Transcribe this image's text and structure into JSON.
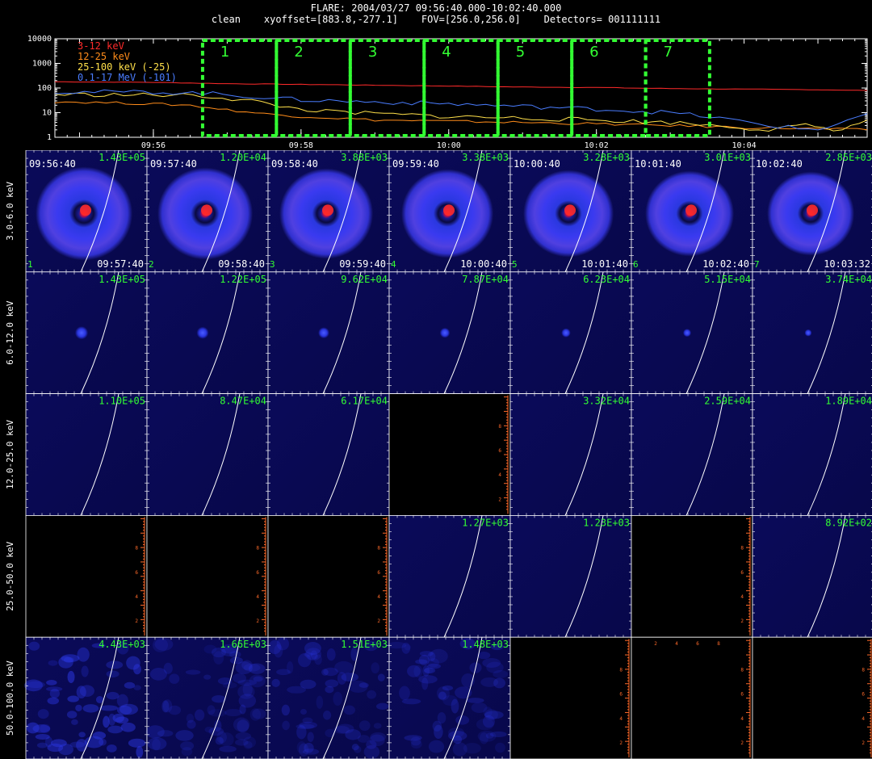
{
  "header": {
    "line1": "FLARE: 2004/03/27 09:56:40.000-10:02:40.000",
    "line2": "clean    xyoffset=[883.8,-277.1]    FOV=[256.0,256.0]    Detectors= 001111111"
  },
  "colors": {
    "band_3_12": "#ff2a2a",
    "band_12_25": "#ff8c1a",
    "band_25_100": "#ffe04a",
    "band_01_17": "#4a7dff",
    "interval_box": "#33ff33",
    "image_label": "#33ff33",
    "axis": "#ffffff",
    "frame_axis": "#ff6a2a"
  },
  "chart_data": [
    {
      "type": "line",
      "title": "",
      "xlabel": "",
      "ylabel": "",
      "y_scale": "log",
      "ylim": [
        1,
        10000
      ],
      "xlim": [
        "09:54:40",
        "10:05:40"
      ],
      "y_ticks": [
        "1",
        "10",
        "100",
        "1000",
        "10000"
      ],
      "x_ticks": [
        "09:56",
        "09:58",
        "10:00",
        "10:02",
        "10:04"
      ],
      "legend_position": "top-left",
      "series": [
        {
          "name": "3-12 keV",
          "color_key": "band_3_12",
          "points": [
            [
              "09:54:40",
              180
            ],
            [
              "09:56:00",
              170
            ],
            [
              "09:57:00",
              150
            ],
            [
              "09:58:00",
              140
            ],
            [
              "09:59:00",
              130
            ],
            [
              "10:00:00",
              120
            ],
            [
              "10:01:00",
              110
            ],
            [
              "10:02:00",
              105
            ],
            [
              "10:03:00",
              95
            ],
            [
              "10:04:00",
              90
            ],
            [
              "10:05:00",
              85
            ],
            [
              "10:05:40",
              80
            ]
          ]
        },
        {
          "name": "12-25 keV",
          "color_key": "band_12_25",
          "points": [
            [
              "09:54:40",
              28
            ],
            [
              "09:55:30",
              25
            ],
            [
              "09:56:30",
              20
            ],
            [
              "09:57:00",
              13
            ],
            [
              "09:57:30",
              9
            ],
            [
              "09:58:00",
              7
            ],
            [
              "09:58:30",
              6
            ],
            [
              "09:59:00",
              5
            ],
            [
              "10:00:00",
              4.5
            ],
            [
              "10:01:00",
              4
            ],
            [
              "10:02:00",
              3.5
            ],
            [
              "10:03:00",
              3
            ],
            [
              "10:04:00",
              2.5
            ],
            [
              "10:05:00",
              2.2
            ],
            [
              "10:05:40",
              2
            ]
          ]
        },
        {
          "name": "25-100 keV (-25)",
          "color_key": "band_25_100",
          "points": [
            [
              "09:54:40",
              55
            ],
            [
              "09:56:00",
              52
            ],
            [
              "09:56:40",
              48
            ],
            [
              "09:57:20",
              30
            ],
            [
              "09:57:50",
              16
            ],
            [
              "09:58:20",
              11
            ],
            [
              "09:59:00",
              9
            ],
            [
              "10:00:00",
              7
            ],
            [
              "10:01:00",
              6
            ],
            [
              "10:02:00",
              5
            ],
            [
              "10:03:00",
              4
            ],
            [
              "10:03:40",
              3
            ],
            [
              "10:04:20",
              2
            ],
            [
              "10:04:50",
              3
            ],
            [
              "10:05:20",
              2
            ],
            [
              "10:05:40",
              5
            ]
          ]
        },
        {
          "name": "0.1-17 MeV (-101)",
          "color_key": "band_01_17",
          "points": [
            [
              "09:54:40",
              70
            ],
            [
              "09:56:00",
              68
            ],
            [
              "09:56:40",
              62
            ],
            [
              "09:57:30",
              42
            ],
            [
              "09:58:00",
              33
            ],
            [
              "09:59:00",
              27
            ],
            [
              "10:00:00",
              23
            ],
            [
              "10:01:00",
              18
            ],
            [
              "10:02:00",
              14
            ],
            [
              "10:03:00",
              10
            ],
            [
              "10:03:40",
              6
            ],
            [
              "10:04:20",
              3
            ],
            [
              "10:05:00",
              2
            ],
            [
              "10:05:40",
              9
            ]
          ]
        }
      ],
      "intervals": [
        {
          "label": "1",
          "start": "09:56:40",
          "end": "09:57:40"
        },
        {
          "label": "2",
          "start": "09:57:40",
          "end": "09:58:40"
        },
        {
          "label": "3",
          "start": "09:58:40",
          "end": "09:59:40"
        },
        {
          "label": "4",
          "start": "09:59:40",
          "end": "10:00:40"
        },
        {
          "label": "5",
          "start": "10:00:40",
          "end": "10:01:40"
        },
        {
          "label": "6",
          "start": "10:01:40",
          "end": "10:02:40"
        },
        {
          "label": "7",
          "start": "10:02:40",
          "end": "10:03:32"
        }
      ]
    },
    {
      "type": "heatmap",
      "title": "",
      "rows": [
        "3.0-6.0 keV",
        "6.0-12.0 keV",
        "12.0-25.0 keV",
        "25.0-50.0 keV",
        "50.0-100.0 keV"
      ],
      "columns": [
        {
          "index": "1",
          "start": "09:56:40",
          "end": "09:57:40"
        },
        {
          "index": "2",
          "start": "09:57:40",
          "end": "09:58:40"
        },
        {
          "index": "3",
          "start": "09:58:40",
          "end": "09:59:40"
        },
        {
          "index": "4",
          "start": "09:59:40",
          "end": "10:00:40"
        },
        {
          "index": "5",
          "start": "10:00:40",
          "end": "10:01:40"
        },
        {
          "index": "6",
          "start": "10:01:40",
          "end": "10:02:40"
        },
        {
          "index": "7",
          "start": "10:02:40",
          "end": "10:03:32"
        }
      ],
      "max_values": [
        [
          "1.43E+05",
          "1.20E+04",
          "3.88E+03",
          "3.38E+03",
          "3.28E+03",
          "3.01E+03",
          "2.85E+03"
        ],
        [
          "1.43E+05",
          "1.22E+05",
          "9.62E+04",
          "7.87E+04",
          "6.23E+04",
          "5.15E+04",
          "3.74E+04"
        ],
        [
          "1.10E+05",
          "8.47E+04",
          "6.17E+04",
          null,
          "3.32E+04",
          "2.59E+04",
          "1.89E+04"
        ],
        [
          null,
          null,
          null,
          "1.27E+03",
          "1.23E+03",
          null,
          "8.92E+02"
        ],
        [
          "4.43E+03",
          "1.66E+03",
          "1.51E+03",
          "1.48E+03",
          null,
          null,
          null
        ]
      ],
      "frame_axis_ticks": [
        "2",
        "4",
        "6",
        "8"
      ],
      "image_kind": [
        [
          "ring",
          "ring",
          "ring",
          "ring",
          "ring",
          "ring",
          "ring"
        ],
        [
          "dot",
          "dot",
          "dot",
          "dot",
          "dot",
          "dot",
          "dot"
        ],
        [
          "faint",
          "faint",
          "faint",
          "empty",
          "faint",
          "faint",
          "faint"
        ],
        [
          "empty",
          "empty",
          "empty",
          "faint",
          "faint",
          "empty",
          "faint"
        ],
        [
          "noise",
          "noise",
          "noise",
          "noise",
          "empty",
          "empty",
          "empty"
        ]
      ]
    }
  ]
}
